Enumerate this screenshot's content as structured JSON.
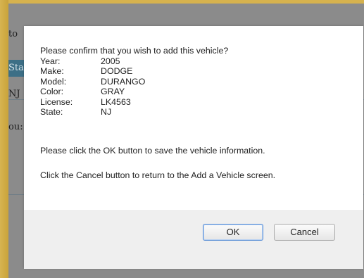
{
  "background_page": {
    "fragments": {
      "to": "to",
      "sta": "Sta",
      "nj": "NJ",
      "you": "ou:"
    }
  },
  "dialog": {
    "prompt": "Please confirm that you wish to add this vehicle?",
    "fields": [
      {
        "label": "Year:",
        "value": "2005"
      },
      {
        "label": "Make:",
        "value": "DODGE"
      },
      {
        "label": "Model:",
        "value": "DURANGO"
      },
      {
        "label": "Color:",
        "value": "GRAY"
      },
      {
        "label": "License:",
        "value": "LK4563"
      },
      {
        "label": "State:",
        "value": "NJ"
      }
    ],
    "ok_instruction": "Please click the OK button to save the vehicle information.",
    "cancel_instruction": "Click the Cancel button to return to the Add a Vehicle screen.",
    "buttons": {
      "ok": "OK",
      "cancel": "Cancel"
    }
  },
  "colors": {
    "gold": "#c9a63a",
    "overlay": "#8b8b8b",
    "focus_border": "#5a8fd6"
  }
}
